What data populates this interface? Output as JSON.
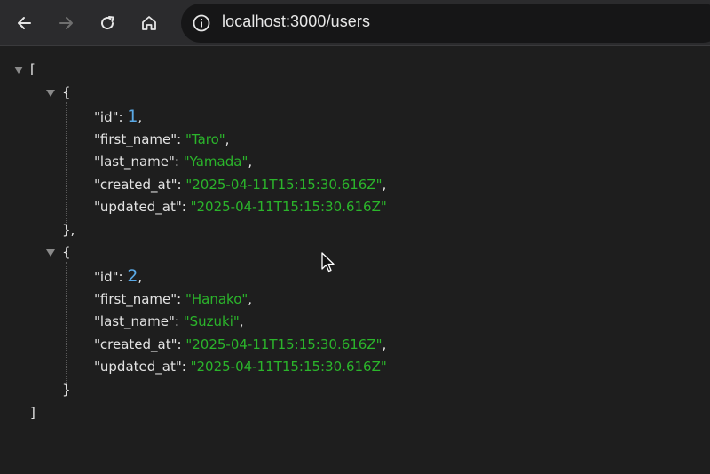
{
  "browser": {
    "url": "localhost:3000/users"
  },
  "icons": {
    "back": "arrow-left-icon",
    "forward": "arrow-right-icon",
    "reload": "reload-icon",
    "home": "home-icon",
    "info": "info-circle-icon"
  },
  "json": {
    "open_array": "[",
    "close_array": "]",
    "open_obj": "{",
    "close_obj_comma": "},",
    "close_obj": "}",
    "users": [
      {
        "id_key": "\"id\"",
        "id": "1",
        "first_name_key": "\"first_name\"",
        "first_name": "\"Taro\"",
        "last_name_key": "\"last_name\"",
        "last_name": "\"Yamada\"",
        "created_at_key": "\"created_at\"",
        "created_at": "\"2025-04-11T15:15:30.616Z\"",
        "updated_at_key": "\"updated_at\"",
        "updated_at": "\"2025-04-11T15:15:30.616Z\""
      },
      {
        "id_key": "\"id\"",
        "id": "2",
        "first_name_key": "\"first_name\"",
        "first_name": "\"Hanako\"",
        "last_name_key": "\"last_name\"",
        "last_name": "\"Suzuki\"",
        "created_at_key": "\"created_at\"",
        "created_at": "\"2025-04-11T15:15:30.616Z\"",
        "updated_at_key": "\"updated_at\"",
        "updated_at": "\"2025-04-11T15:15:30.616Z\""
      }
    ]
  }
}
